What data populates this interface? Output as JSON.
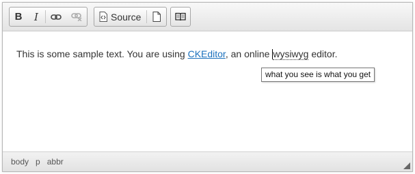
{
  "toolbar": {
    "bold_label": "B",
    "italic_label": "I",
    "link_icon": "link-icon",
    "unlink_icon": "unlink-icon",
    "source_label": "Source",
    "source_icon": "source-icon",
    "newpage_icon": "new-page-icon",
    "book_icon": "book-icon"
  },
  "content": {
    "text_before": "This is some sample text. You are using ",
    "link_text": "CKEditor",
    "text_middle": ", an online ",
    "abbr_text": "wysiwyg",
    "text_after": " editor.",
    "tooltip": "what you see is what you get"
  },
  "path": {
    "items": [
      "body",
      "p",
      "abbr"
    ]
  },
  "colors": {
    "link": "#1a70bd",
    "toolbar_bg": "#e4e4e4",
    "border": "#b6b6b6"
  }
}
